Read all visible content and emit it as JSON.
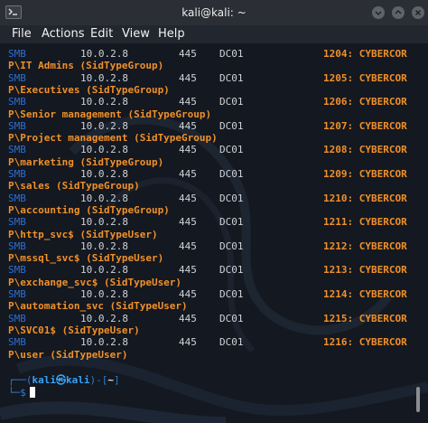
{
  "window": {
    "title": "kali@kali: ~",
    "icon": "terminal-icon",
    "controls": [
      "minimize-icon",
      "maximize-icon",
      "close-icon"
    ]
  },
  "menu": [
    "File",
    "Actions",
    "Edit",
    "View",
    "Help"
  ],
  "rows": [
    {
      "proto": "SMB",
      "ip": "10.0.2.8",
      "port": "445",
      "host": "DC01",
      "rid": "1204: CYBERCOR",
      "group": "P\\IT Admins (SidTypeGroup)"
    },
    {
      "proto": "SMB",
      "ip": "10.0.2.8",
      "port": "445",
      "host": "DC01",
      "rid": "1205: CYBERCOR",
      "group": "P\\Executives (SidTypeGroup)"
    },
    {
      "proto": "SMB",
      "ip": "10.0.2.8",
      "port": "445",
      "host": "DC01",
      "rid": "1206: CYBERCOR",
      "group": "P\\Senior management (SidTypeGroup)"
    },
    {
      "proto": "SMB",
      "ip": "10.0.2.8",
      "port": "445",
      "host": "DC01",
      "rid": "1207: CYBERCOR",
      "group": "P\\Project management (SidTypeGroup)"
    },
    {
      "proto": "SMB",
      "ip": "10.0.2.8",
      "port": "445",
      "host": "DC01",
      "rid": "1208: CYBERCOR",
      "group": "P\\marketing (SidTypeGroup)"
    },
    {
      "proto": "SMB",
      "ip": "10.0.2.8",
      "port": "445",
      "host": "DC01",
      "rid": "1209: CYBERCOR",
      "group": "P\\sales (SidTypeGroup)"
    },
    {
      "proto": "SMB",
      "ip": "10.0.2.8",
      "port": "445",
      "host": "DC01",
      "rid": "1210: CYBERCOR",
      "group": "P\\accounting (SidTypeGroup)"
    },
    {
      "proto": "SMB",
      "ip": "10.0.2.8",
      "port": "445",
      "host": "DC01",
      "rid": "1211: CYBERCOR",
      "group": "P\\http_svc$ (SidTypeUser)"
    },
    {
      "proto": "SMB",
      "ip": "10.0.2.8",
      "port": "445",
      "host": "DC01",
      "rid": "1212: CYBERCOR",
      "group": "P\\mssql_svc$ (SidTypeUser)"
    },
    {
      "proto": "SMB",
      "ip": "10.0.2.8",
      "port": "445",
      "host": "DC01",
      "rid": "1213: CYBERCOR",
      "group": "P\\exchange_svc$ (SidTypeUser)"
    },
    {
      "proto": "SMB",
      "ip": "10.0.2.8",
      "port": "445",
      "host": "DC01",
      "rid": "1214: CYBERCOR",
      "group": "P\\automation_svc (SidTypeUser)"
    },
    {
      "proto": "SMB",
      "ip": "10.0.2.8",
      "port": "445",
      "host": "DC01",
      "rid": "1215: CYBERCOR",
      "group": "P\\SVC01$ (SidTypeUser)"
    },
    {
      "proto": "SMB",
      "ip": "10.0.2.8",
      "port": "445",
      "host": "DC01",
      "rid": "1216: CYBERCOR",
      "group": "P\\user (SidTypeUser)"
    }
  ],
  "prompt": {
    "line1_prefix": "┌──(",
    "user": "kali㉿kali",
    "line1_mid": ")-[",
    "dir": "~",
    "line1_suffix": "]",
    "line2": "└─$"
  },
  "colors": {
    "smb": "#2a6ed6",
    "highlight": "#f0902a",
    "background": "#141820"
  }
}
